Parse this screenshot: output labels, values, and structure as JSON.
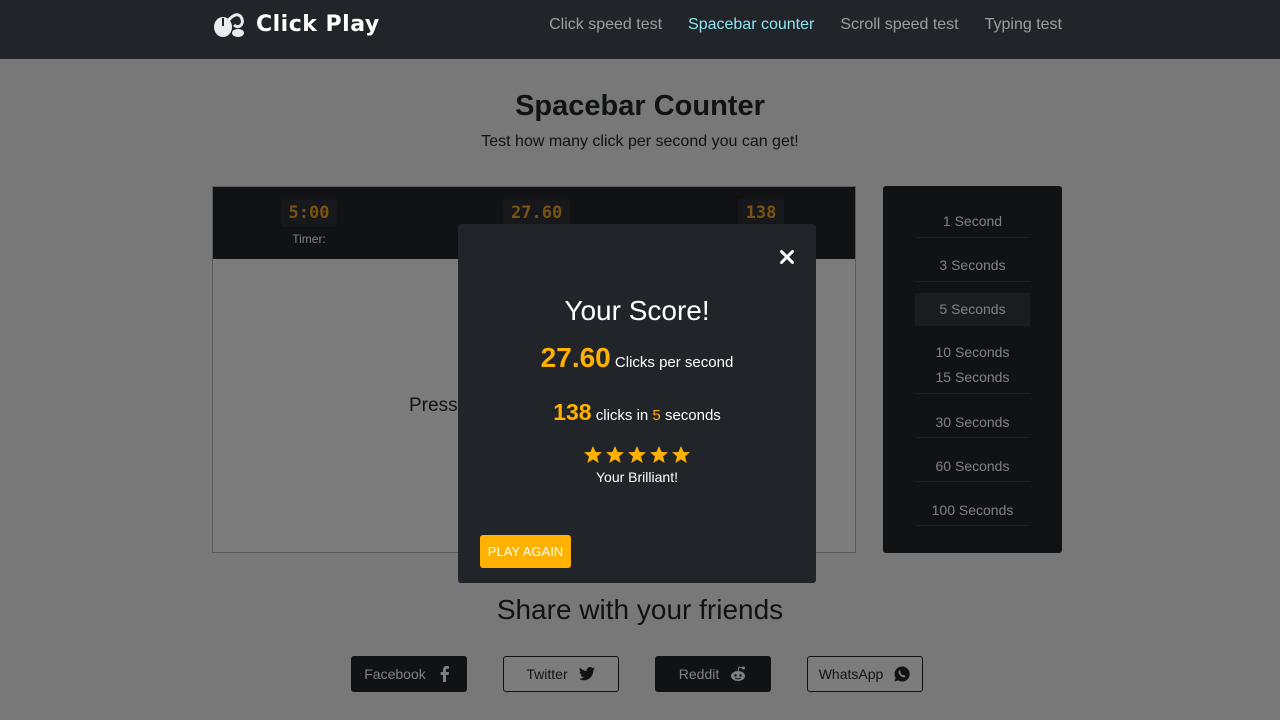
{
  "navbar": {
    "brand": "Click Play",
    "links": [
      "Click speed test",
      "Spacebar counter",
      "Scroll speed test",
      "Typing test"
    ],
    "active_index": 1
  },
  "page": {
    "title": "Spacebar Counter",
    "subtitle": "Test how many click per second you can get!"
  },
  "game": {
    "timer_value": "5:00",
    "timer_label": "Timer:",
    "cps_value": "27.60",
    "clicks_value": "138",
    "press_text": "Press"
  },
  "durations": {
    "items": [
      "1 Second",
      "3 Seconds",
      "5 Seconds",
      "10 Seconds",
      "15 Seconds",
      "30 Seconds",
      "60 Seconds",
      "100 Seconds"
    ],
    "selected_index": 2
  },
  "share": {
    "title": "Share with your friends",
    "buttons": [
      "Facebook",
      "Twitter",
      "Reddit",
      "WhatsApp"
    ]
  },
  "modal": {
    "title": "Your Score!",
    "cps": "27.60",
    "cps_label": "Clicks per second",
    "clicks": "138",
    "clicks_in": "clicks in",
    "seconds": "5",
    "seconds_label": "seconds",
    "stars": 5,
    "rating_text": "Your Brilliant!",
    "play_again": "PLAY AGAIN"
  },
  "colors": {
    "accent": "#ffb100",
    "dark": "#212529",
    "active_nav": "#8fe3f0"
  }
}
